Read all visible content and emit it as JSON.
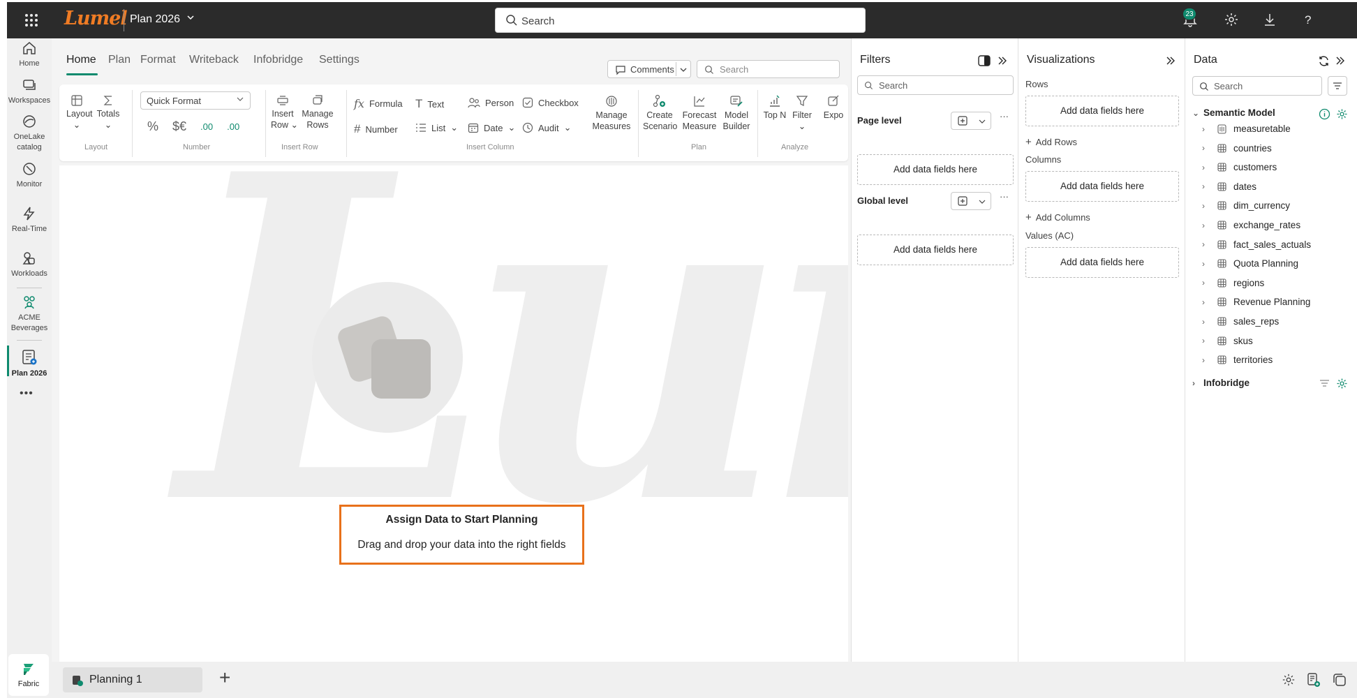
{
  "topbar": {
    "logo_text": "Lumel",
    "plan_title": "Plan 2026",
    "search_placeholder": "Search",
    "notification_count": "23",
    "colors": {
      "bar": "#2b2b2b",
      "accent": "#0f8a6e",
      "logo": "#f07c24"
    }
  },
  "rail": {
    "items": [
      {
        "label": "Home",
        "icon": "home-icon"
      },
      {
        "label": "Workspaces",
        "icon": "workspaces-icon"
      },
      {
        "label1": "OneLake",
        "label2": "catalog",
        "icon": "onelake-icon"
      },
      {
        "label": "Monitor",
        "icon": "monitor-icon"
      },
      {
        "label": "Real-Time",
        "icon": "lightning-icon"
      },
      {
        "label": "Workloads",
        "icon": "workloads-icon"
      },
      {
        "label1": "ACME",
        "label2": "Beverages",
        "icon": "acme-icon"
      },
      {
        "label": "Plan 2026",
        "icon": "plan-icon"
      }
    ],
    "more": "•••",
    "fabric_label": "Fabric"
  },
  "ribbon": {
    "tabs": [
      "Home",
      "Plan",
      "Format",
      "Writeback",
      "Infobridge",
      "Settings"
    ],
    "comments_label": "Comments",
    "search_placeholder": "Search",
    "layout": {
      "layout": "Layout",
      "totals": "Totals",
      "group": "Layout"
    },
    "number": {
      "quick_format": "Quick Format",
      "percent": "%",
      "currency": "$€",
      "dec1": ".00",
      "dec2": ".00",
      "group": "Number"
    },
    "insert_row": {
      "insert_row1": "Insert",
      "insert_row2": "Row",
      "manage_rows1": "Manage",
      "manage_rows2": "Rows",
      "group": "Insert Row"
    },
    "insert_column": {
      "formula": "Formula",
      "text": "Text",
      "person": "Person",
      "checkbox": "Checkbox",
      "number": "Number",
      "list": "List",
      "date": "Date",
      "audit": "Audit",
      "manage_measures1": "Manage",
      "manage_measures2": "Measures",
      "group": "Insert Column"
    },
    "plan": {
      "create1": "Create",
      "create2": "Scenario",
      "forecast1": "Forecast",
      "forecast2": "Measure",
      "model1": "Model",
      "model2": "Builder",
      "group": "Plan"
    },
    "analyze": {
      "topn": "Top N",
      "filter": "Filter",
      "export": "Expo",
      "group": "Analyze"
    }
  },
  "canvas": {
    "watermark": "Lumel",
    "empty_title": "Assign Data to Start Planning",
    "empty_subtitle": "Drag and drop your data into the right fields"
  },
  "bottombar": {
    "page_tab": "Planning 1",
    "add": "+"
  },
  "filters": {
    "title": "Filters",
    "search_placeholder": "Search",
    "page_level": "Page level",
    "global_level": "Global level",
    "add_fields": "Add data fields here"
  },
  "visualizations": {
    "title": "Visualizations",
    "rows": "Rows",
    "add_rows": "Add Rows",
    "columns": "Columns",
    "add_columns": "Add Columns",
    "values": "Values (AC)",
    "add_fields": "Add data fields here"
  },
  "data": {
    "title": "Data",
    "search_placeholder": "Search",
    "semantic_model": "Semantic Model",
    "tables": [
      "measuretable",
      "countries",
      "customers",
      "dates",
      "dim_currency",
      "exchange_rates",
      "fact_sales_actuals",
      "Quota Planning",
      "regions",
      "Revenue Planning",
      "sales_reps",
      "skus",
      "territories"
    ],
    "infobridge": "Infobridge"
  }
}
